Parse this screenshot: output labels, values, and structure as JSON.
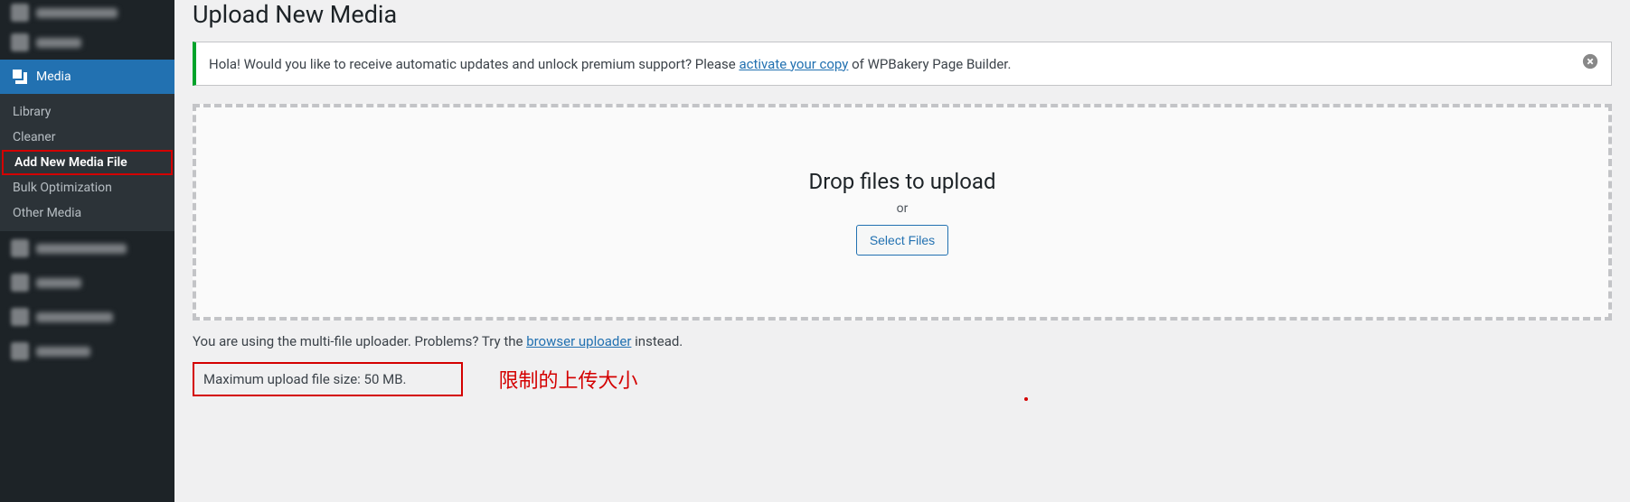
{
  "sidebar": {
    "media_label": "Media",
    "submenu": {
      "library": "Library",
      "cleaner": "Cleaner",
      "add_new": "Add New Media File",
      "bulk_opt": "Bulk Optimization",
      "other_media": "Other Media"
    }
  },
  "page": {
    "title": "Upload New Media",
    "notice": {
      "prefix": "Hola! Would you like to receive automatic updates and unlock premium support? Please ",
      "link": "activate your copy",
      "suffix": " of WPBakery Page Builder."
    },
    "dropzone": {
      "drop_text": "Drop files to upload",
      "or_text": "or",
      "select_button": "Select Files"
    },
    "hint": {
      "prefix": "You are using the multi-file uploader. Problems? Try the ",
      "link": "browser uploader",
      "suffix": " instead."
    },
    "max_size": "Maximum upload file size: 50 MB.",
    "annotation_cn": "限制的上传大小"
  }
}
